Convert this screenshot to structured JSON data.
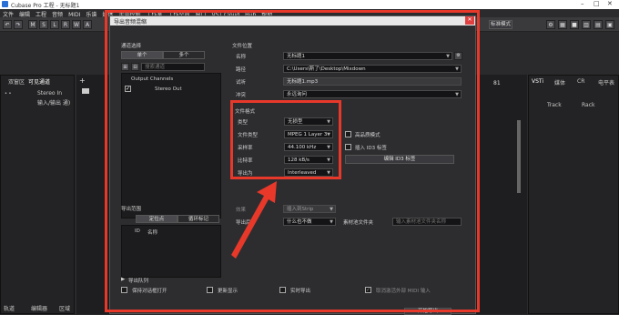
{
  "app": {
    "title": "Cubase Pro 工程 - 无标题1"
  },
  "menu": [
    "文件",
    "编辑",
    "工程",
    "音频",
    "MIDI",
    "乐谱",
    "媒体",
    "走带控制",
    "工作室",
    "工作空间",
    "窗口",
    "VST Cloud",
    "Hub",
    "帮助"
  ],
  "toolbar": {
    "marker_btn": "标准模式"
  },
  "left_panel": {
    "tabs": [
      "双窗区",
      "可见通道"
    ],
    "track": "Stereo In",
    "sub": "输入/输出 通)",
    "bottom_tabs": [
      "轨道",
      "编辑器",
      "区域"
    ]
  },
  "right_panel": {
    "tabs": [
      "VSTi",
      "媒体",
      "CR",
      "电平表"
    ],
    "track_label": "Track",
    "rack_label": "Rack",
    "marker": "81"
  },
  "dialog": {
    "title": "导出音频混缩",
    "channel_section": "通道选择",
    "mode_single": "单个",
    "mode_multi": "多个",
    "search_placeholder": "搜索通道",
    "output_channels": "Output Channels",
    "stereo_out": "Stereo Out",
    "file_location": "文件位置",
    "name_label": "名称",
    "name_value": "无标题1",
    "path_label": "路径",
    "path_value": "C:\\Users\\斯了\\Desktop\\Mixdown",
    "preview_label": "试听",
    "preview_value": "无标题1.mp3",
    "conflict_label": "冲突",
    "conflict_value": "永远询问",
    "format_section": "文件格式",
    "format_label": "类型",
    "format_value": "无损型",
    "filetype_label": "文件类型",
    "filetype_value": "MPEG 1 Layer 3",
    "rate_label": "采样率",
    "rate_value": "44.100 kHz",
    "bitrate_label": "比特率",
    "bitrate_value": "128 kB/s",
    "export_as_label": "导出为",
    "export_as_value": "Interleaved",
    "hq_label": "高品质模式",
    "id3_label": "插入 ID3 标签",
    "edit_id3": "编辑 ID3 标签",
    "post_label": "效果",
    "post_value": "插入到Strip",
    "after_label": "导出后",
    "after_value": "什么也不做",
    "pool_label": "素材池文件夹",
    "pool_placeholder": "输入素材池文件夹名称",
    "range_section": "导出范围",
    "range_tab1": "定位点",
    "range_tab2": "循环标记",
    "col_id": "ID",
    "col_name": "名称",
    "queue_label": "导出队列",
    "keep_open": "保持对话框打开",
    "update_display": "更新显示",
    "realtime": "实时导出",
    "midi_export": "取消激活外部 MIDI 输入",
    "render_btn": "开始导出"
  }
}
